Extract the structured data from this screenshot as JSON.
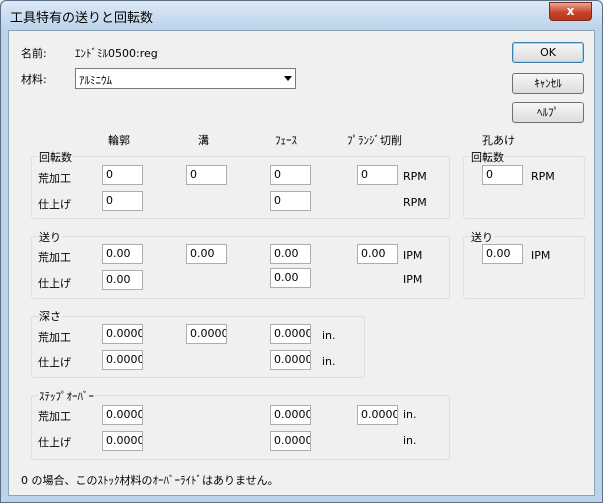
{
  "window": {
    "title": "工具特有の送りと回転数",
    "close_label": "x"
  },
  "name_label": "名前:",
  "name_value": "ｴﾝﾄﾞﾐﾙ0500:reg",
  "material_label": "材料:",
  "material_value": "ｱﾙﾐﾆｳﾑ",
  "buttons": {
    "ok": "OK",
    "cancel": "ｷｬﾝｾﾙ",
    "help": "ﾍﾙﾌﾟ"
  },
  "columns": {
    "outer": "輪郭",
    "groove": "溝",
    "face": "ﾌｪｰｽ",
    "flange": "ﾌﾟﾗﾝｼﾞ切削",
    "drill": "孔あけ"
  },
  "rpm_group": {
    "title": "回転数",
    "rough_label": "荒加工",
    "finish_label": "仕上げ",
    "rough": {
      "outer": "0",
      "groove": "0",
      "face": "0",
      "flange": "0"
    },
    "finish": {
      "outer": "0",
      "face": "0"
    },
    "unit_rough": "RPM",
    "unit_finish": "RPM"
  },
  "drill_rpm_group": {
    "title": "回転数",
    "value": "0",
    "unit": "RPM"
  },
  "feed_group": {
    "title": "送り",
    "rough_label": "荒加工",
    "finish_label": "仕上げ",
    "rough": {
      "outer": "0.00",
      "groove": "0.00",
      "face": "0.00",
      "flange": "0.00"
    },
    "finish": {
      "outer": "0.00",
      "face": "0.00"
    },
    "unit_rough": "IPM",
    "unit_finish": "IPM"
  },
  "drill_feed_group": {
    "title": "送り",
    "value": "0.00",
    "unit": "IPM"
  },
  "depth_group": {
    "title": "深さ",
    "rough_label": "荒加工",
    "finish_label": "仕上げ",
    "rough": {
      "outer": "0.0000",
      "groove": "0.0000",
      "face": "0.0000"
    },
    "finish": {
      "outer": "0.0000",
      "face": "0.0000"
    },
    "unit_rough": "in.",
    "unit_finish": "in."
  },
  "stepover_group": {
    "title": "ｽﾃｯﾌﾟｵｰﾊﾞｰ",
    "rough_label": "荒加工",
    "finish_label": "仕上げ",
    "rough": {
      "outer": "0.0000",
      "face": "0.0000",
      "flange": "0.0000"
    },
    "finish": {
      "outer": "0.0000",
      "face": "0.0000"
    },
    "unit_rough": "in.",
    "unit_finish": "in."
  },
  "footer_note": "0 の場合、このｽﾄｯｸ材料のｵｰﾊﾞｰﾗｲﾄﾞはありません。"
}
